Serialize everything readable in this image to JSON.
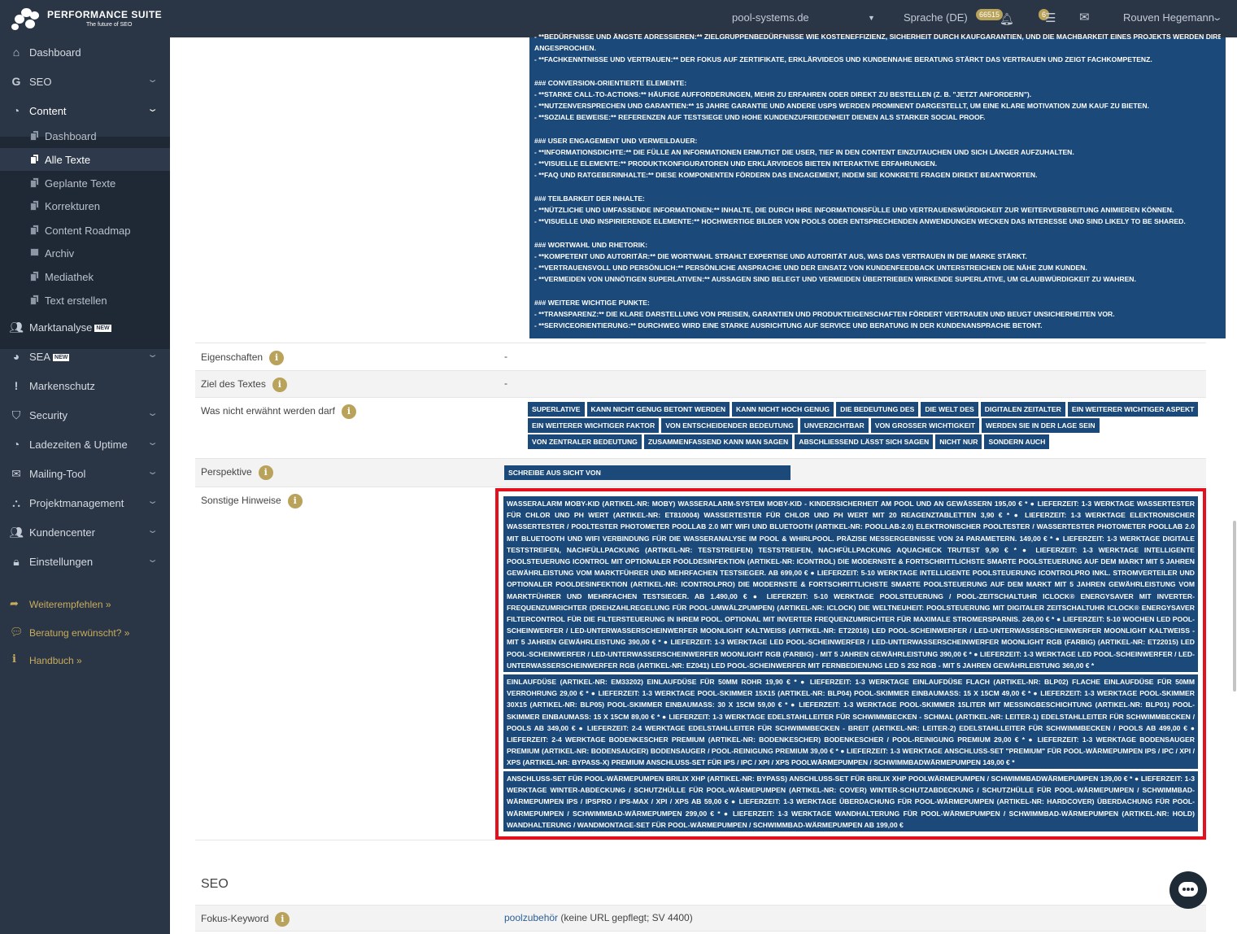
{
  "header": {
    "brand": "PERFORMANCE SUITE",
    "tagline": "The future of SEO",
    "domain": "pool-systems.de",
    "language": "Sprache (DE)",
    "credits": "66515",
    "notif_count": "6",
    "user": "Rouven Hegemann"
  },
  "sidebar": {
    "dashboard": "Dashboard",
    "seo": "SEO",
    "content": "Content",
    "content_sub": [
      "Dashboard",
      "Alle Texte",
      "Geplante Texte",
      "Korrekturen",
      "Content Roadmap",
      "Archiv",
      "Mediathek",
      "Text erstellen"
    ],
    "marktanalyse": "Marktanalyse",
    "sea": "SEA",
    "new_badge": "NEW",
    "markenschutz": "Markenschutz",
    "security": "Security",
    "ladezeiten": "Ladezeiten & Uptime",
    "mailing": "Mailing-Tool",
    "projekt": "Projektmanagement",
    "kunden": "Kundencenter",
    "einstellungen": "Einstellungen",
    "help": [
      "Weiterempfehlen »",
      "Beratung erwünscht? »",
      "Handbuch »"
    ]
  },
  "top_text": [
    "- **BEDÜRFNISSE UND ÄNGSTE ADRESSIEREN:** ZIELGRUPPENBEDÜRFNISSE WIE KOSTENEFFIZIENZ, SICHERHEIT DURCH KAUFGARANTIEN, UND DIE MACHBARKEIT EINES PROJEKTS WERDEN DIREKT",
    "ANGESPROCHEN.",
    "- **FACHKENNTNISSE UND VERTRAUEN:** DER FOKUS AUF ZERTIFIKATE, ERKLÄRVIDEOS UND KUNDENNAHE BERATUNG STÄRKT DAS VERTRAUEN UND ZEIGT FACHKOMPETENZ.",
    "",
    "### CONVERSION-ORIENTIERTE ELEMENTE:",
    "- **STARKE CALL-TO-ACTIONS:** HÄUFIGE AUFFORDERUNGEN, MEHR ZU ERFAHREN ODER DIREKT ZU BESTELLEN (Z. B. \"JETZT ANFORDERN\").",
    "- **NUTZENVERSPRECHEN UND GARANTIEN:** 15 JAHRE GARANTIE UND ANDERE USPS WERDEN PROMINENT DARGESTELLT, UM EINE KLARE MOTIVATION ZUM KAUF ZU BIETEN.",
    "- **SOZIALE BEWEISE:** REFERENZEN AUF TESTSIEGE UND HOHE KUNDENZUFRIEDENHEIT DIENEN ALS STARKER SOCIAL PROOF.",
    "",
    "### USER ENGAGEMENT UND VERWEILDAUER:",
    "- **INFORMATIONSDICHTE:** DIE FÜLLE AN INFORMATIONEN ERMUTIGT DIE USER, TIEF IN DEN CONTENT EINZUTAUCHEN UND SICH LÄNGER AUFZUHALTEN.",
    "- **VISUELLE ELEMENTE:** PRODUKTKONFIGURATOREN UND ERKLÄRVIDEOS BIETEN INTERAKTIVE ERFAHRUNGEN.",
    "- **FAQ UND RATGEBERINHALTE:** DIESE KOMPONENTEN FÖRDERN DAS ENGAGEMENT, INDEM SIE KONKRETE FRAGEN DIREKT BEANTWORTEN.",
    "",
    "### TEILBARKEIT DER INHALTE:",
    "- **NÜTZLICHE UND UMFASSENDE INFORMATIONEN:** INHALTE, DIE DURCH IHRE INFORMATIONSFÜLLE UND VERTRAUENSWÜRDIGKEIT ZUR WEITERVERBREITUNG ANIMIEREN KÖNNEN.",
    "- **VISUELLE UND INSPIRIERENDE ELEMENTE:** HOCHWERTIGE BILDER VON POOLS ODER ENTSPRECHENDEN ANWENDUNGEN WECKEN DAS INTERESSE UND SIND LIKELY TO BE SHARED.",
    "",
    "### WORTWAHL UND RHETORIK:",
    "- **KOMPETENT UND AUTORITÄR:** DIE WORTWAHL STRAHLT EXPERTISE UND AUTORITÄT AUS, WAS DAS VERTRAUEN IN DIE MARKE STÄRKT.",
    "- **VERTRAUENSVOLL UND PERSÖNLICH:** PERSÖNLICHE ANSPRACHE UND DER EINSATZ VON KUNDENFEEDBACK UNTERSTREICHEN DIE NÄHE ZUM KUNDEN.",
    "- **VERMEIDEN VON UNNÖTIGEN SUPERLATIVEN:** AUSSAGEN SIND BELEGT UND VERMEIDEN ÜBERTRIEBEN WIRKENDE SUPERLATIVE, UM GLAUBWÜRDIGKEIT ZU WAHREN.",
    "",
    "### WEITERE WICHTIGE PUNKTE:",
    "- **TRANSPARENZ:** DIE KLARE DARSTELLUNG VON PREISEN, GARANTIEN UND PRODUKTEIGENSCHAFTEN FÖRDERT VERTRAUEN UND BEUGT UNSICHERHEITEN VOR.",
    "- **SERVICEORIENTIERUNG:** DURCHWEG WIRD EINE STARKE AUSRICHTUNG AUF SERVICE UND BERATUNG IN DER KUNDENANSPRACHE BETONT."
  ],
  "fields": {
    "eigenschaften_label": "Eigenschaften",
    "eigenschaften_value": "-",
    "ziel_label": "Ziel des Textes",
    "ziel_value": "-",
    "verboten_label": "Was nicht erwähnt werden darf",
    "verboten": [
      "SUPERLATIVE",
      "KANN NICHT GENUG BETONT WERDEN",
      "KANN NICHT HOCH GENUG",
      "DIE BEDEUTUNG DES",
      "DIE WELT DES",
      "DIGITALEN ZEITALTER",
      "EIN WEITERER WICHTIGER ASPEKT",
      "EIN WEITERER WICHTIGER FAKTOR",
      "VON ENTSCHEIDENDER BEDEUTUNG",
      "UNVERZICHTBAR",
      "VON GROSSER WICHTIGKEIT",
      "WERDEN SIE IN DER LAGE SEIN",
      "VON ZENTRALER BEDEUTUNG",
      "ZUSAMMENFASSEND KANN MAN SAGEN",
      "ABSCHLIESSEND LÄSST SICH SAGEN",
      "NICHT NUR",
      "SONDERN AUCH"
    ],
    "perspektive_label": "Perspektive",
    "perspektive_value": "SCHREIBE AUS SICHT VON",
    "hinweise_label": "Sonstige Hinweise",
    "hinweise": [
      "WASSERALARM MOBY-KID (ARTIKEL-NR: MOBY) WASSERALARM-SYSTEM MOBY-KID - KINDERSICHERHEIT AM POOL UND AN GEWÄSSERN 195,00 € * ● LIEFERZEIT: 1-3 WERKTAGE WASSERTESTER FÜR CHLOR UND PH WERT (ARTIKEL-NR: ET810004) WASSERTESTER FÜR CHLOR UND PH WERT MIT 20 REAGENZTABLETTEN 3,90 € * ● LIEFERZEIT: 1-3 WERKTAGE ELEKTRONISCHER WASSERTESTER / POOLTESTER PHOTOMETER POOLLAB 2.0 MIT WIFI UND BLUETOOTH (ARTIKEL-NR: POOLLAB-2.0) ELEKTRONISCHER POOLTESTER / WASSERTESTER PHOTOMETER POOLLAB 2.0 MIT BLUETOOTH UND WIFI VERBINDUNG FÜR DIE WASSERANALYSE IM POOL & WHIRLPOOL. PRÄZISE MESSERGEBNISSE VON 24 PARAMETERN. 149,00 € * ● LIEFERZEIT: 1-3 WERKTAGE DIGITALE TESTSTREIFEN, NACHFÜLLPACKUNG (ARTIKEL-NR: TESTSTREIFEN) TESTSTREIFEN, NACHFÜLLPACKUNG AQUACHECK TRUTEST 9,90 € * ● LIEFERZEIT: 1-3 WERKTAGE INTELLIGENTE POOLSTEUERUNG ICONTROL MIT OPTIONALER POOLDESINFEKTION (ARTIKEL-NR: ICONTROL) DIE MODERNSTE & FORTSCHRITTLICHSTE SMARTE POOLSTEUERUNG AUF DEM MARKT MIT 5 JAHREN GEWÄHRLEISTUNG VOM MARKTFÜHRER UND MEHRFACHEN TESTSIEGER. AB 699,00 € ● LIEFERZEIT: 5-10 WERKTAGE INTELLIGENTE POOLSTEUERUNG ICONTROLPRO INKL. STROMVERTEILER UND OPTIONALER POOLDESINFEKTION (ARTIKEL-NR: ICONTROLPRO) DIE MODERNSTE & FORTSCHRITTLICHSTE SMARTE POOLSTEUERUNG AUF DEM MARKT MIT 5 JAHREN GEWÄHRLEISTUNG VOM MARKTFÜHRER UND MEHRFACHEN TESTSIEGER. AB 1.490,00 € ● LIEFERZEIT: 5-10 WERKTAGE POOLSTEUERUNG / POOL-ZEITSCHALTUHR ICLOCK® ENERGYSAVER MIT INVERTER-FREQUENZUMRICHTER (DREHZAHLREGELUNG FÜR POOL-UMWÄLZPUMPEN) (ARTIKEL-NR: ICLOCK) DIE WELTNEUHEIT: POOLSTEUERUNG MIT DIGITALER ZEITSCHALTUHR ICLOCK® ENERGYSAVER FILTERCONTROL FÜR DIE FILTERSTEUERUNG IN IHREM POOL. OPTIONAL MIT INVERTER FREQUENZUMRICHTER FÜR MAXIMALE STROMERSPARNIS. 249,00 € * ● LIEFERZEIT: 5-10 WOCHEN LED POOL-SCHEINWERFER / LED-UNTERWASSERSCHEINWERFER MOONLIGHT KALTWEISS (ARTIKEL-NR: ET22016) LED POOL-SCHEINWERFER / LED-UNTERWASSERSCHEINWERFER MOONLIGHT KALTWEISS - MIT 5 JAHREN GEWÄHRLEISTUNG 390,00 € * ● LIEFERZEIT: 1-3 WERKTAGE LED POOL-SCHEINWERFER / LED-UNTERWASSERSCHEINWERFER MOONLIGHT RGB (FARBIG) (ARTIKEL-NR: ET22015) LED POOL-SCHEINWERFER / LED-UNTERWASSERSCHEINWERFER MOONLIGHT RGB (FARBIG) - MIT 5 JAHREN GEWÄHRLEISTUNG 390,00 € * ● LIEFERZEIT: 1-3 WERKTAGE LED POOL-SCHEINWERFER / LED-UNTERWASSERSCHEINWERFER RGB (ARTIKEL-NR: EZ041) LED POOL-SCHEINWERFER MIT FERNBEDIENUNG LED S 252 RGB - MIT 5 JAHREN GEWÄHRLEISTUNG 369,00 € *",
      "EINLAUFDÜSE (ARTIKEL-NR: EM33202) EINLAUFDÜSE FÜR 50MM ROHR 19,90 € * ● LIEFERZEIT: 1-3 WERKTAGE EINLAUFDÜSE FLACH (ARTIKEL-NR: BLP02) FLACHE EINLAUFDÜSE FÜR 50MM VERROHRUNG 29,00 € * ● LIEFERZEIT: 1-3 WERKTAGE POOL-SKIMMER 15X15 (ARTIKEL-NR: BLP04) POOL-SKIMMER EINBAUMASS: 15 X 15CM 49,00 € * ● LIEFERZEIT: 1-3 WERKTAGE POOL-SKIMMER 30X15 (ARTIKEL-NR: BLP05) POOL-SKIMMER EINBAUMASS: 30 X 15CM 59,00 € * ● LIEFERZEIT: 1-3 WERKTAGE POOL-SKIMMER 15LITER MIT MESSINGBESCHICHTUNG (ARTIKEL-NR: BLP01) POOL-SKIMMER EINBAUMASS: 15 X 15CM 89,00 € * ● LIEFERZEIT: 1-3 WERKTAGE EDELSTAHLLEITER FÜR SCHWIMMBECKEN - SCHMAL (ARTIKEL-NR: LEITER-1) EDELSTAHLLEITER FÜR SCHWIMMBECKEN / POOLS AB 349,00 € ● LIEFERZEIT: 2-4 WERKTAGE EDELSTAHLLEITER FÜR SCHWIMMBECKEN - BREIT (ARTIKEL-NR: LEITER-2) EDELSTAHLLEITER FÜR SCHWIMMBECKEN / POOLS AB 499,00 € ● LIEFERZEIT: 2-4 WERKTAGE BODENKESCHER PREMIUM (ARTIKEL-NR: BODENKESCHER) BODENKESCHER / POOL-REINIGUNG PREMIUM 29,00 € * ● LIEFERZEIT: 1-3 WERKTAGE BODENSAUGER PREMIUM (ARTIKEL-NR: BODENSAUGER) BODENSAUGER / POOL-REINIGUNG PREMIUM 39,00 € * ● LIEFERZEIT: 1-3 WERKTAGE ANSCHLUSS-SET \"PREMIUM\" FÜR POOL-WÄRMEPUMPEN IPS / IPC / XPI / XPS (ARTIKEL-NR: BYPASS-X) PREMIUM ANSCHLUSS-SET FÜR IPS / IPC / XPI / XPS POOLWÄRMEPUMPEN / SCHWIMMBADWÄRMEPUMPEN 149,00 € *",
      "ANSCHLUSS-SET FÜR POOL-WÄRMEPUMPEN BRILIX XHP (ARTIKEL-NR: BYPASS) ANSCHLUSS-SET FÜR BRILIX XHP POOLWÄRMEPUMPEN / SCHWIMMBADWÄRMEPUMPEN 139,00 € * ● LIEFERZEIT: 1-3 WERKTAGE WINTER-ABDECKUNG / SCHUTZHÜLLE FÜR POOL-WÄRMEPUMPEN (ARTIKEL-NR: COVER) WINTER-SCHUTZABDECKUNG / SCHUTZHÜLLE FÜR POOL-WÄRMEPUMPEN / SCHWIMMBAD-WÄRMEPUMPEN IPS / IPSPRO / IPS-MAX / XPI / XPS AB 59,00 € ● LIEFERZEIT: 1-3 WERKTAGE ÜBERDACHUNG FÜR POOL-WÄRMEPUMPEN (ARTIKEL-NR: HARDCOVER) ÜBERDACHUNG FÜR POOL-WÄRMEPUMPEN / SCHWIMMBAD-WÄRMEPUMPEN 299,00 € * ● LIEFERZEIT: 1-3 WERKTAGE WANDHALTERUNG FÜR POOL-WÄRMEPUMPEN / SCHWIMMBAD-WÄRMEPUMPEN (ARTIKEL-NR: HOLD) WANDHALTERUNG / WANDMONTAGE-SET FÜR POOL-WÄRMEPUMPEN / SCHWIMMBAD-WÄRMEPUMPEN AB 199,00 €"
    ]
  },
  "seo": {
    "heading": "SEO",
    "focus_label": "Fokus-Keyword",
    "focus_keyword": "poolzubehör",
    "focus_note": " (keine URL gepflegt; SV 4400)"
  },
  "colors": {
    "sidebar": "#2a3545",
    "accent": "#b9a25a",
    "blue": "#1b4a7a",
    "highlight": "#e3101e"
  }
}
